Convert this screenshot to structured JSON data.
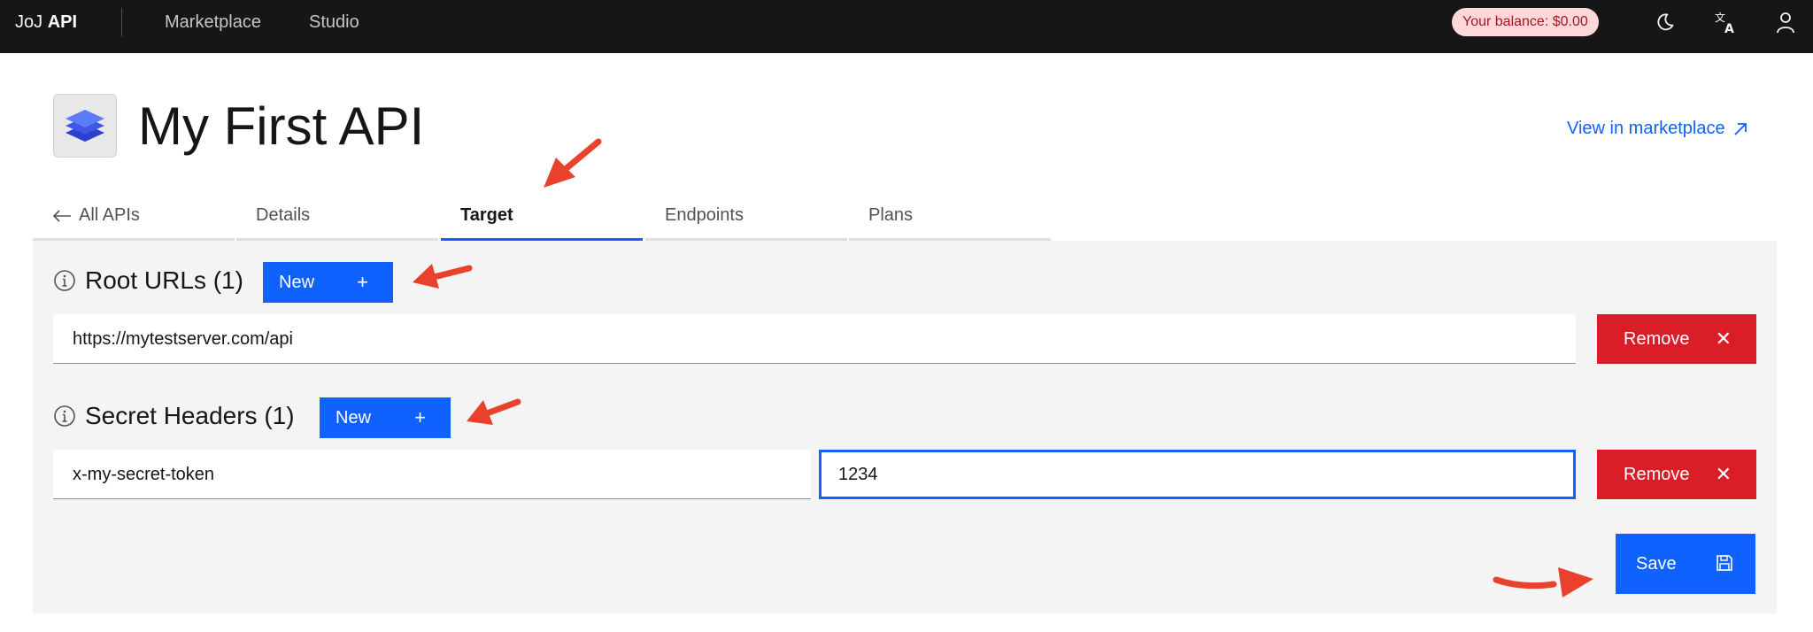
{
  "topbar": {
    "brand_prefix": "JoJ",
    "brand_suffix": "API",
    "nav": [
      "Marketplace",
      "Studio"
    ],
    "balance": "Your balance: $0.00"
  },
  "header": {
    "title": "My First API",
    "view_link": "View in marketplace"
  },
  "tabs": [
    {
      "label": "All APIs"
    },
    {
      "label": "Details"
    },
    {
      "label": "Target",
      "active": true
    },
    {
      "label": "Endpoints"
    },
    {
      "label": "Plans"
    }
  ],
  "root_urls": {
    "title": "Root URLs (1)",
    "new_label": "New",
    "items": [
      {
        "value": "https://mytestserver.com/api",
        "remove_label": "Remove"
      }
    ]
  },
  "secret_headers": {
    "title": "Secret Headers (1)",
    "new_label": "New",
    "items": [
      {
        "key": "x-my-secret-token",
        "value": "1234",
        "remove_label": "Remove"
      }
    ]
  },
  "save_label": "Save",
  "colors": {
    "primary": "#0f62fe",
    "danger": "#da1e28",
    "topbar": "#161616",
    "panel": "#f4f4f4",
    "annotation_arrow": "#e8412c"
  }
}
